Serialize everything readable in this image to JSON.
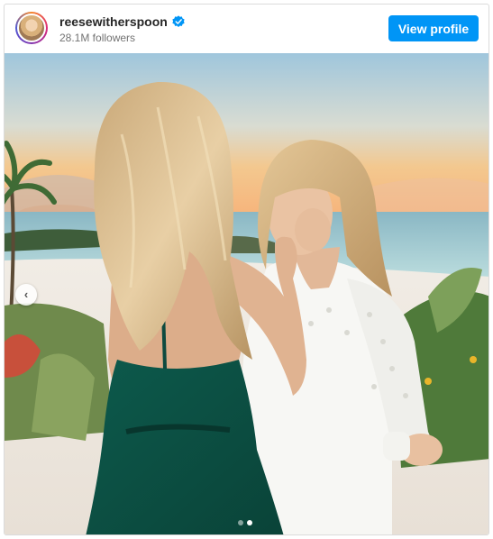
{
  "header": {
    "username": "reesewitherspoon",
    "verified_icon": "verified-badge-icon",
    "followers": "28.1M followers",
    "view_profile_label": "View profile"
  },
  "carousel": {
    "prev_icon": "chevron-left-icon",
    "total_slides": 2,
    "active_slide": 2
  },
  "colors": {
    "button": "#0095f6",
    "dress_green": "#0f5a4c",
    "verified": "#0095f6"
  }
}
